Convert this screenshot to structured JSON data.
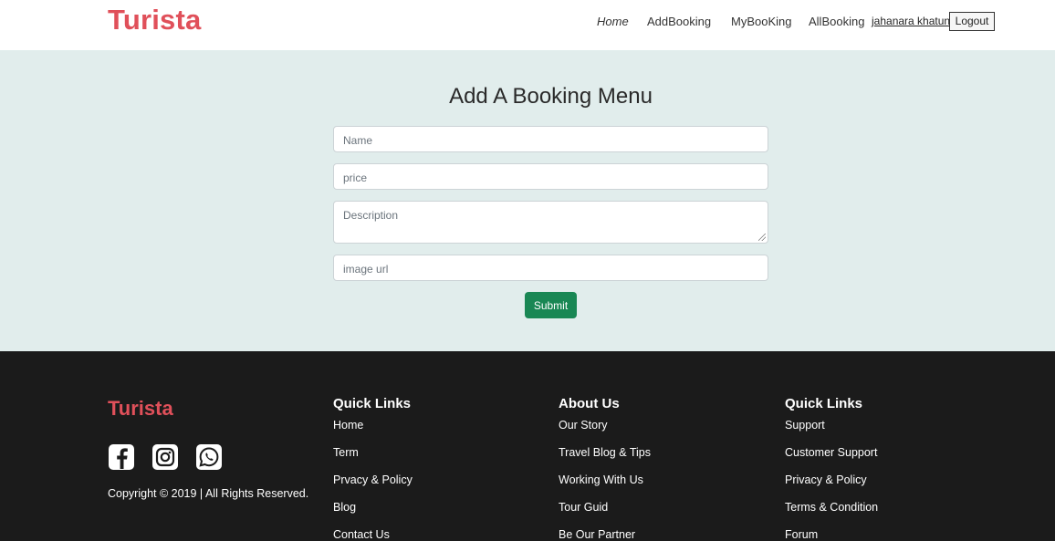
{
  "header": {
    "brand": "Turista",
    "nav": [
      "Home",
      "AddBooking",
      "MyBooKing",
      "AllBooking"
    ],
    "user": "jahanara khatun",
    "logout": "Logout"
  },
  "form": {
    "title": "Add A Booking Menu",
    "name_placeholder": "Name",
    "price_placeholder": "price",
    "description_placeholder": "Description",
    "image_placeholder": "image url",
    "submit_label": "Submit"
  },
  "footer": {
    "brand": "Turista",
    "social_icons": [
      "facebook-icon",
      "instagram-icon",
      "whatsapp-icon"
    ],
    "copyright": "Copyright © 2019 | All Rights Reserved.",
    "columns": [
      {
        "title": "Quick Links",
        "links": [
          "Home",
          "Term",
          "Prvacy & Policy",
          "Blog",
          "Contact Us"
        ]
      },
      {
        "title": "About Us",
        "links": [
          "Our Story",
          "Travel Blog & Tips",
          "Working With Us",
          "Tour Guid",
          "Be Our Partner"
        ]
      },
      {
        "title": "Quick Links",
        "links": [
          "Support",
          "Customer Support",
          "Privacy & Policy",
          "Terms & Condition",
          "Forum"
        ]
      }
    ]
  },
  "colors": {
    "brand": "#e0505a",
    "main_bg": "#e1edec",
    "footer_bg": "#1b1b1b",
    "submit": "#198754"
  }
}
